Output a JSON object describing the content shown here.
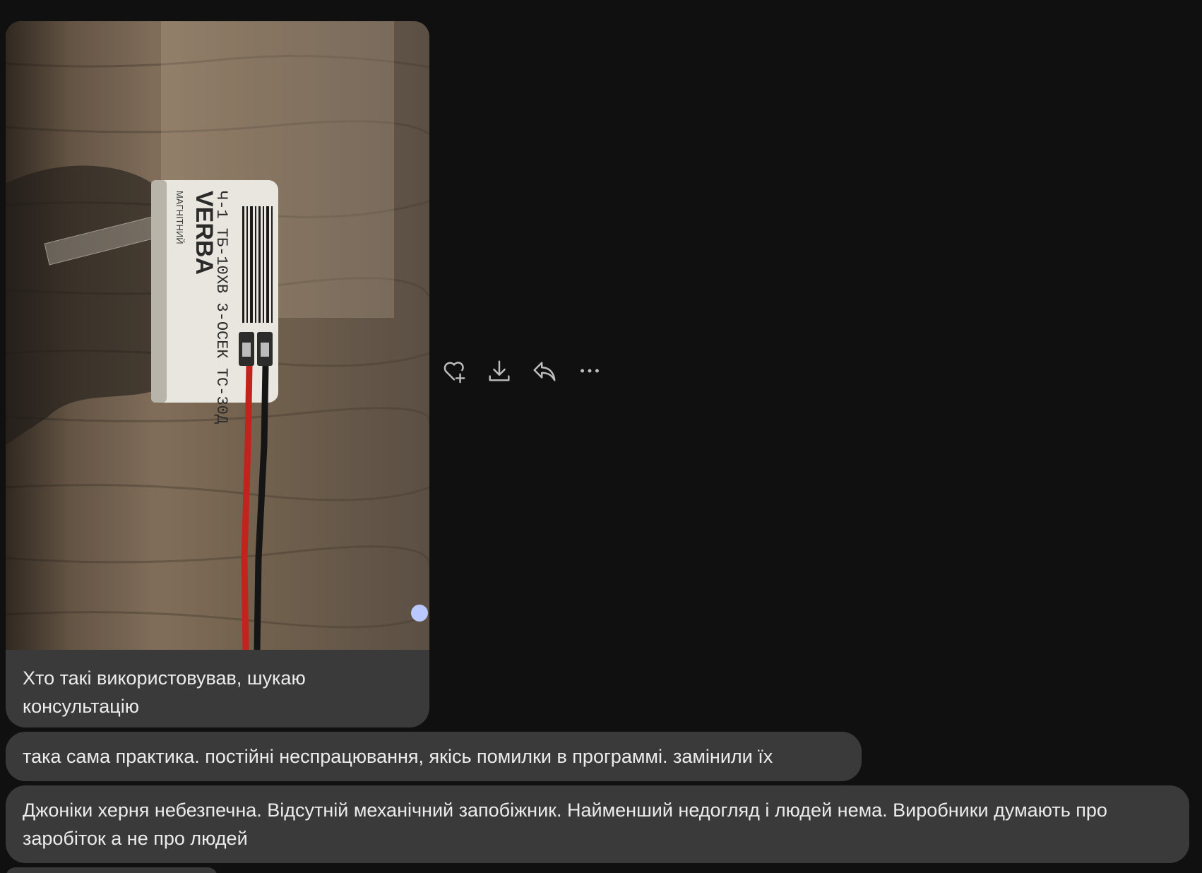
{
  "messages": [
    {
      "type": "photo",
      "photo_label": {
        "brand": "VERBA",
        "subtitle": "МАГНІТНИЙ",
        "model": "Ч-1 ТБ-10ХВ 3-ОСЕК ТС-30Д"
      },
      "caption": "Хто такі використовував, шукаю консультацію"
    },
    {
      "type": "text",
      "text": "така сама практика. постійні неспрацювання, якісь помилки в программі. замінили їх"
    },
    {
      "type": "text",
      "text": "Джоніки херня небезпечна. Відсутній механічний запобіжник. Найменший недогляд і людей нема. Виробники думають про заробіток а не про людей"
    }
  ],
  "actions": [
    {
      "icon": "heart-plus-icon",
      "name": "react-button"
    },
    {
      "icon": "download-icon",
      "name": "download-button"
    },
    {
      "icon": "reply-icon",
      "name": "reply-button"
    },
    {
      "icon": "more-icon",
      "name": "more-button"
    }
  ],
  "colors": {
    "background": "#101010",
    "bubble": "#3a3a3a",
    "text": "#ececec",
    "icon": "#bdbdbd",
    "unread_dot": "#b9c8ff"
  }
}
